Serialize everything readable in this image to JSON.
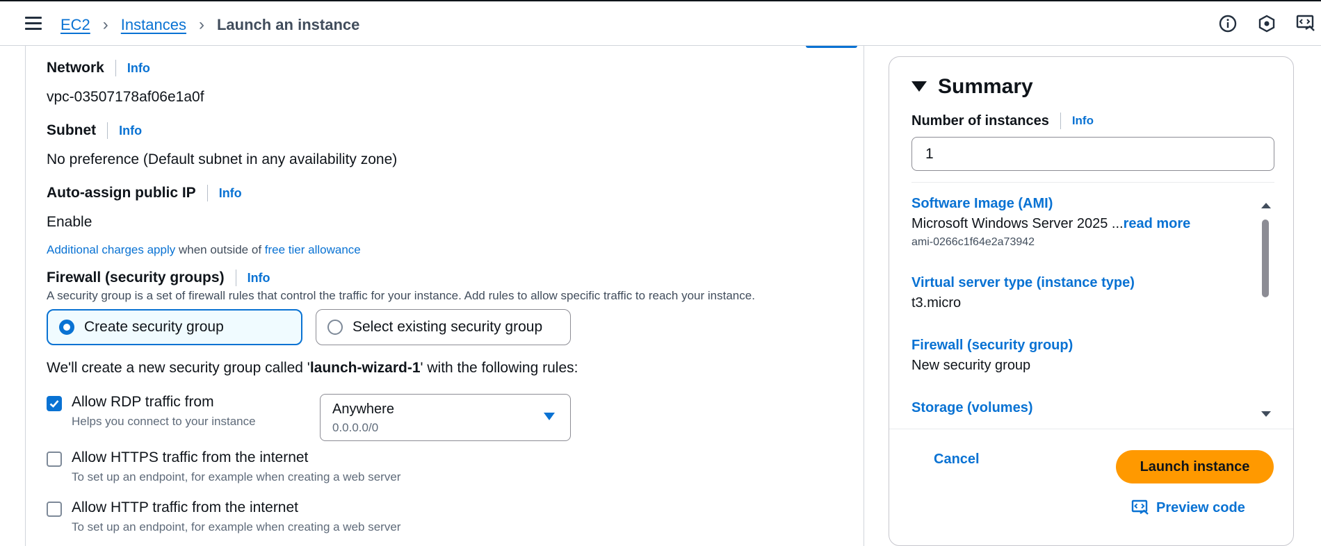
{
  "breadcrumb": {
    "items": [
      "EC2",
      "Instances"
    ],
    "current": "Launch an instance"
  },
  "header_icons": [
    "info-circle-icon",
    "settings-shield-icon",
    "preview-code-icon"
  ],
  "network": {
    "label": "Network",
    "info": "Info",
    "value": "vpc-03507178af06e1a0f"
  },
  "subnet": {
    "label": "Subnet",
    "info": "Info",
    "value": "No preference (Default subnet in any availability zone)"
  },
  "public_ip": {
    "label": "Auto-assign public IP",
    "info": "Info",
    "value": "Enable",
    "note_link1": "Additional charges apply",
    "note_mid": " when outside of ",
    "note_link2": "free tier allowance"
  },
  "firewall": {
    "label": "Firewall (security groups)",
    "info": "Info",
    "description": "A security group is a set of firewall rules that control the traffic for your instance. Add rules to allow specific traffic to reach your instance.",
    "options": [
      {
        "label": "Create security group",
        "selected": true
      },
      {
        "label": "Select existing security group",
        "selected": false
      }
    ],
    "sg_desc_pre": "We'll create a new security group called '",
    "sg_name": "launch-wizard-1",
    "sg_desc_post": "' with the following rules:"
  },
  "rules": [
    {
      "label": "Allow RDP traffic from",
      "help": "Helps you connect to your instance",
      "checked": true
    },
    {
      "label": "Allow HTTPS traffic from the internet",
      "help": "To set up an endpoint, for example when creating a web server",
      "checked": false
    },
    {
      "label": "Allow HTTP traffic from the internet",
      "help": "To set up an endpoint, for example when creating a web server",
      "checked": false
    }
  ],
  "rdp_source": {
    "value": "Anywhere",
    "sub": "0.0.0.0/0"
  },
  "summary": {
    "title": "Summary",
    "num_label": "Number of instances",
    "info": "Info",
    "num_value": "1",
    "sections": [
      {
        "title": "Software Image (AMI)",
        "value": "Microsoft Windows Server 2025 ...",
        "read_more": "read more",
        "sub": "ami-0266c1f64e2a73942"
      },
      {
        "title": "Virtual server type (instance type)",
        "value": "t3.micro"
      },
      {
        "title": "Firewall (security group)",
        "value": "New security group"
      },
      {
        "title": "Storage (volumes)"
      }
    ],
    "cancel": "Cancel",
    "launch": "Launch instance",
    "preview": "Preview code"
  },
  "colors": {
    "link": "#0972d3",
    "primary_button": "#ff9900",
    "selected_tile_bg": "#f0fbff"
  }
}
